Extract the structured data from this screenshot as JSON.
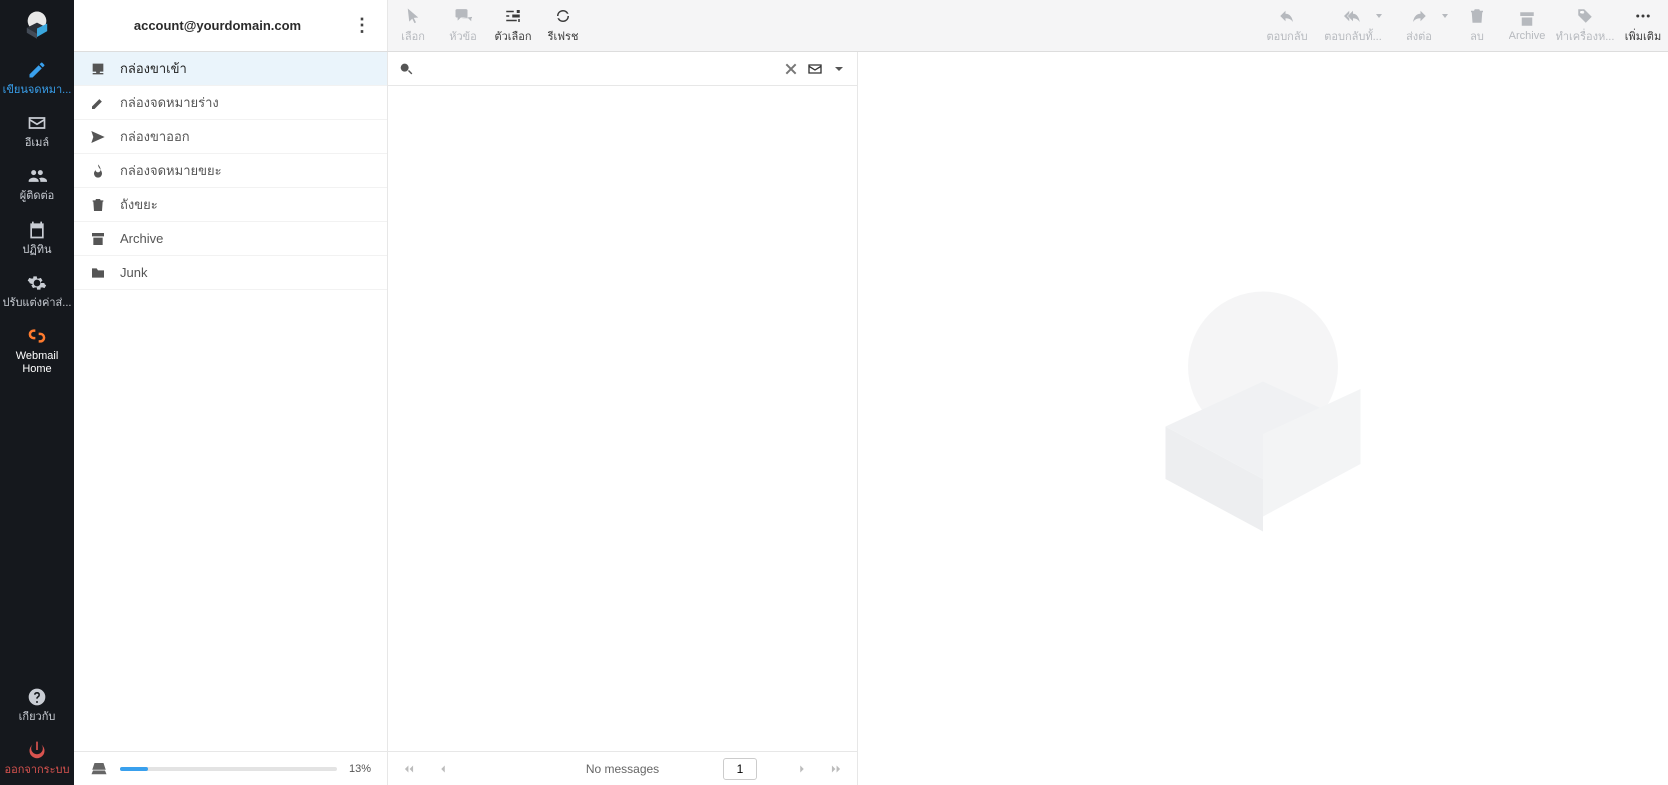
{
  "account": {
    "email": "account@yourdomain.com"
  },
  "rail": {
    "compose": "เขียนจดหมา...",
    "email": "อีเมล์",
    "contacts": "ผู้ติดต่อ",
    "calendar": "ปฏิทิน",
    "settings": "ปรับแต่งค่าส่...",
    "webmail_home": "Webmail Home",
    "about": "เกี่ยวกับ",
    "logout": "ออกจากระบบ"
  },
  "toolbar_left": {
    "select": "เลือก",
    "threads": "หัวข้อ",
    "options": "ตัวเลือก",
    "refresh": "รีเฟรช"
  },
  "toolbar_right": {
    "reply": "ตอบกลับ",
    "reply_all": "ตอบกลับทั้...",
    "forward": "ส่งต่อ",
    "delete": "ลบ",
    "archive": "Archive",
    "mark": "ทำเครื่องห...",
    "more": "เพิ่มเติม"
  },
  "folders": [
    {
      "label": "กล่องขาเข้า",
      "icon": "inbox",
      "active": true
    },
    {
      "label": "กล่องจดหมายร่าง",
      "icon": "pencil"
    },
    {
      "label": "กล่องขาออก",
      "icon": "send"
    },
    {
      "label": "กล่องจดหมายขยะ",
      "icon": "fire"
    },
    {
      "label": "ถังขยะ",
      "icon": "trash"
    },
    {
      "label": "Archive",
      "icon": "archive"
    },
    {
      "label": "Junk",
      "icon": "folder"
    }
  ],
  "quota": {
    "percent_text": "13%",
    "percent": 13
  },
  "search": {
    "placeholder": ""
  },
  "pager": {
    "status": "No messages",
    "page": "1"
  }
}
